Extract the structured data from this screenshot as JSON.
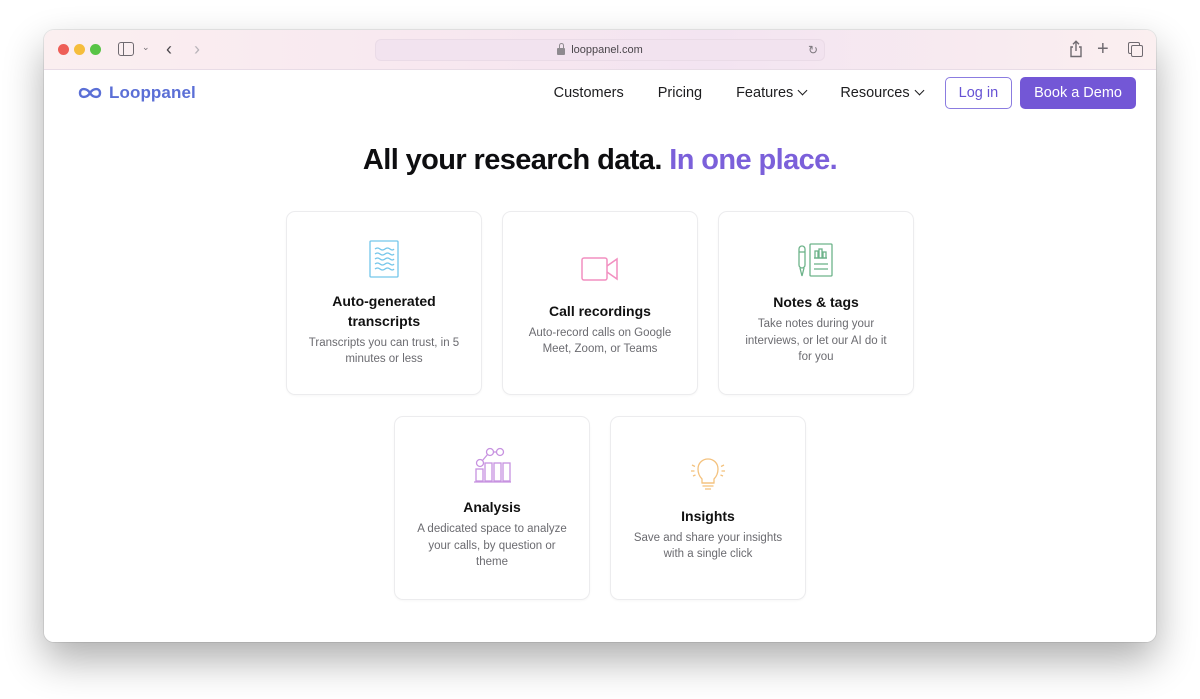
{
  "browser": {
    "url": "looppanel.com",
    "icons": [
      "sidebar-icon",
      "chevron-down-icon",
      "back-icon",
      "forward-icon",
      "lock-icon",
      "reload-icon",
      "share-icon",
      "new-tab-icon",
      "tabs-overview-icon"
    ]
  },
  "header": {
    "logo_text": "Looppanel",
    "nav": [
      {
        "label": "Customers",
        "has_dropdown": false
      },
      {
        "label": "Pricing",
        "has_dropdown": false
      },
      {
        "label": "Features",
        "has_dropdown": true
      },
      {
        "label": "Resources",
        "has_dropdown": true
      }
    ],
    "login_label": "Log in",
    "demo_label": "Book a Demo"
  },
  "hero": {
    "headline_main": "All your research data.",
    "headline_accent": "In one place."
  },
  "features": [
    {
      "icon": "transcript-document-icon",
      "title": "Auto-generated transcripts",
      "desc": "Transcripts you can trust, in 5 minutes or less",
      "color": "#74c6ea"
    },
    {
      "icon": "video-camera-icon",
      "title": "Call recordings",
      "desc": "Auto-record calls on Google Meet, Zoom, or Teams",
      "color": "#f28fc0"
    },
    {
      "icon": "pen-and-notes-icon",
      "title": "Notes & tags",
      "desc": "Take notes during your interviews, or let our AI do it for you",
      "color": "#6db38a"
    },
    {
      "icon": "analysis-chart-icon",
      "title": "Analysis",
      "desc": "A dedicated space to analyze your calls, by question or theme",
      "color": "#c792e0"
    },
    {
      "icon": "lightbulb-icon",
      "title": "Insights",
      "desc": "Save and share your insights with a single click",
      "color": "#f4c27e"
    }
  ],
  "colors": {
    "brand_blue": "#5b6fd6",
    "brand_purple": "#7357d6",
    "accent_headline": "#7b60da"
  }
}
